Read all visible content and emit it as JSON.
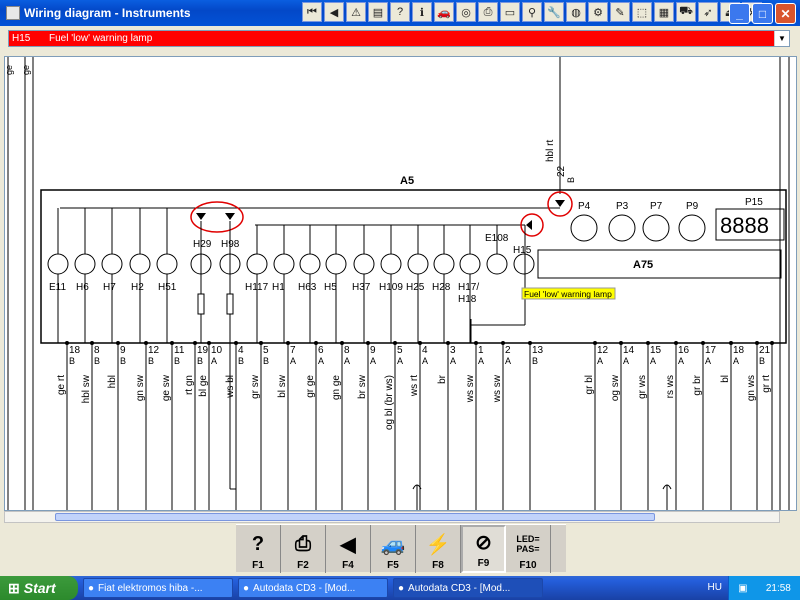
{
  "window": {
    "title": "Wiring diagram - Instruments"
  },
  "toolbar_icons": [
    "first-page-icon",
    "prev-icon",
    "warning-icon",
    "book-icon",
    "help-icon",
    "info-icon",
    "car-icon",
    "tire-icon",
    "print-icon",
    "display-icon",
    "filter-icon",
    "wrench-icon",
    "oil-icon",
    "settings-icon",
    "paint-icon",
    "part-icon",
    "ruler-icon",
    "car-repair-icon",
    "rocket-icon",
    "eject-icon",
    "tools-icon"
  ],
  "component_selector": {
    "code": "H15",
    "name": "Fuel 'low' warning lamp"
  },
  "diagram": {
    "module_label": "A5",
    "submodule_label": "A75",
    "side_labels": [
      "ge",
      "ge"
    ],
    "top_wire_label": "hbl rt",
    "top_wire_pin": "22",
    "top_wire_pin_sub": "B",
    "warning_labels": [
      "E11",
      "H6",
      "H7",
      "H2",
      "H51"
    ],
    "led_labels": [
      "H29",
      "H98"
    ],
    "lamp_labels": [
      "H117",
      "H1",
      "H63",
      "H5",
      "H37",
      "H109",
      "H25",
      "H28",
      "H17/",
      "H18"
    ],
    "e108_label": "E108",
    "h15_label": "H15",
    "gauge_labels": [
      "P4",
      "P3",
      "P7",
      "P9",
      "P15"
    ],
    "lcd_text": "8888",
    "tooltip": "Fuel 'low' warning lamp",
    "pins": [
      {
        "num": "18",
        "conn": "B",
        "wire": "ge rt"
      },
      {
        "num": "8",
        "conn": "B",
        "wire": "hbl sw"
      },
      {
        "num": "9",
        "conn": "B",
        "wire": "hbl"
      },
      {
        "num": "12",
        "conn": "B",
        "wire": "gn sw"
      },
      {
        "num": "11",
        "conn": "B",
        "wire": "ge sw"
      },
      {
        "num": "19",
        "conn": "B",
        "wire": "rt gn"
      },
      {
        "num": "10",
        "conn": "A",
        "wire": "bl ge"
      },
      {
        "num": "4",
        "conn": "B",
        "wire": "ws bl"
      },
      {
        "num": "5",
        "conn": "B",
        "wire": "gr sw"
      },
      {
        "num": "7",
        "conn": "A",
        "wire": "bl sw"
      },
      {
        "num": "6",
        "conn": "A",
        "wire": "gr ge"
      },
      {
        "num": "8",
        "conn": "A",
        "wire": "gn ge"
      },
      {
        "num": "9",
        "conn": "A",
        "wire": "br sw"
      },
      {
        "num": "5",
        "conn": "A",
        "wire": "og bl (br ws)"
      },
      {
        "num": "4",
        "conn": "A",
        "wire": "ws rt"
      },
      {
        "num": "3",
        "conn": "A",
        "wire": "br"
      },
      {
        "num": "1",
        "conn": "A",
        "wire": "ws sw"
      },
      {
        "num": "2",
        "conn": "A",
        "wire": "ws sw"
      },
      {
        "num": "13",
        "conn": "B",
        "wire": ""
      },
      {
        "num": "12",
        "conn": "A",
        "wire": "gr bl"
      },
      {
        "num": "14",
        "conn": "A",
        "wire": "og sw"
      },
      {
        "num": "15",
        "conn": "A",
        "wire": "gr ws"
      },
      {
        "num": "16",
        "conn": "A",
        "wire": "rs ws"
      },
      {
        "num": "17",
        "conn": "A",
        "wire": "gr br"
      },
      {
        "num": "18",
        "conn": "A",
        "wire": "bl"
      },
      {
        "num": "21",
        "conn": "B",
        "wire": "gn ws"
      },
      {
        "num": "",
        "conn": "",
        "wire": "gr rt"
      }
    ]
  },
  "function_keys": [
    {
      "key": "F1",
      "icon": "help-icon"
    },
    {
      "key": "F2",
      "icon": "print-icon"
    },
    {
      "key": "F4",
      "icon": "back-arrow-icon"
    },
    {
      "key": "F5",
      "icon": "car-icon"
    },
    {
      "key": "F8",
      "icon": "wiring-icon"
    },
    {
      "key": "F9",
      "icon": "magnify-wire-icon"
    },
    {
      "key": "F10",
      "icon": "led-pas-icon",
      "text": "LED=\nPAS="
    }
  ],
  "taskbar": {
    "start_label": "Start",
    "tasks": [
      "Fiat elektromos hiba -...",
      "Autodata CD3 - [Mod...",
      "Autodata CD3 - [Mod..."
    ],
    "lang": "HU",
    "clock": "21:58"
  }
}
